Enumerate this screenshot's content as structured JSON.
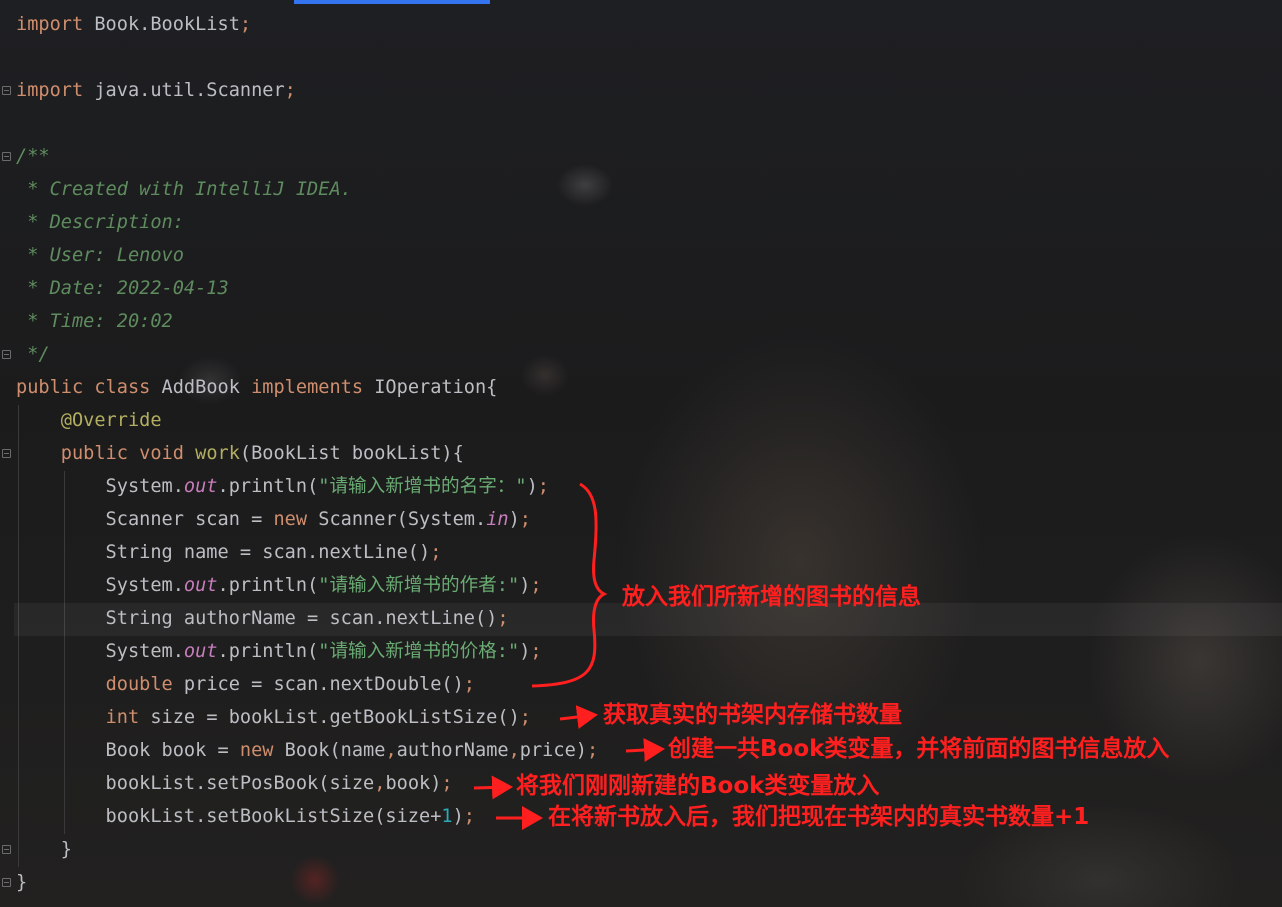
{
  "editor": {
    "lines": [
      [
        {
          "t": "import",
          "c": "kw"
        },
        {
          "t": " Book.BookList"
        },
        {
          "t": ";",
          "c": "kw"
        }
      ],
      [],
      [
        {
          "t": "import",
          "c": "kw"
        },
        {
          "t": " java.util.Scanner"
        },
        {
          "t": ";",
          "c": "kw"
        }
      ],
      [],
      [
        {
          "t": "/**",
          "c": "com"
        }
      ],
      [
        {
          "t": " * Created with IntelliJ IDEA.",
          "c": "com"
        }
      ],
      [
        {
          "t": " * Description:",
          "c": "com"
        }
      ],
      [
        {
          "t": " * User: Lenovo",
          "c": "com"
        }
      ],
      [
        {
          "t": " * Date: 2022-04-13",
          "c": "com"
        }
      ],
      [
        {
          "t": " * Time: 20:02",
          "c": "com"
        }
      ],
      [
        {
          "t": " */",
          "c": "com"
        }
      ],
      [
        {
          "t": "public class",
          "c": "kw"
        },
        {
          "t": " AddBook "
        },
        {
          "t": "implements",
          "c": "kw"
        },
        {
          "t": " IOperation{"
        }
      ],
      [
        {
          "t": "    "
        },
        {
          "t": "@Override",
          "c": "ann"
        }
      ],
      [
        {
          "t": "    "
        },
        {
          "t": "public void",
          "c": "kw"
        },
        {
          "t": " "
        },
        {
          "t": "work",
          "c": "ann"
        },
        {
          "t": "(BookList bookList){"
        }
      ],
      [
        {
          "t": "        System."
        },
        {
          "t": "out",
          "c": "st"
        },
        {
          "t": ".println("
        },
        {
          "t": "\"请输入新增书的名字：\"",
          "c": "str"
        },
        {
          "t": ")"
        },
        {
          "t": ";",
          "c": "kw"
        }
      ],
      [
        {
          "t": "        Scanner scan = "
        },
        {
          "t": "new",
          "c": "kw"
        },
        {
          "t": " Scanner(System."
        },
        {
          "t": "in",
          "c": "st"
        },
        {
          "t": ")"
        },
        {
          "t": ";",
          "c": "kw"
        }
      ],
      [
        {
          "t": "        String name = scan.nextLine()"
        },
        {
          "t": ";",
          "c": "kw"
        }
      ],
      [
        {
          "t": "        System."
        },
        {
          "t": "out",
          "c": "st"
        },
        {
          "t": ".println("
        },
        {
          "t": "\"请输入新增书的作者:\"",
          "c": "str"
        },
        {
          "t": ")"
        },
        {
          "t": ";",
          "c": "kw"
        }
      ],
      [
        {
          "t": "        String authorName = scan.nextLine()"
        },
        {
          "t": ";",
          "c": "kw"
        }
      ],
      [
        {
          "t": "        System."
        },
        {
          "t": "out",
          "c": "st"
        },
        {
          "t": ".println("
        },
        {
          "t": "\"请输入新增书的价格:\"",
          "c": "str"
        },
        {
          "t": ")"
        },
        {
          "t": ";",
          "c": "kw"
        }
      ],
      [
        {
          "t": "        "
        },
        {
          "t": "double",
          "c": "kw"
        },
        {
          "t": " price = scan.nextDouble()"
        },
        {
          "t": ";",
          "c": "kw"
        }
      ],
      [
        {
          "t": "        "
        },
        {
          "t": "int",
          "c": "kw"
        },
        {
          "t": " size = bookList.getBookListSize()"
        },
        {
          "t": ";",
          "c": "kw"
        }
      ],
      [
        {
          "t": "        Book book = "
        },
        {
          "t": "new",
          "c": "kw"
        },
        {
          "t": " Book(name"
        },
        {
          "t": ",",
          "c": "kw"
        },
        {
          "t": "authorName"
        },
        {
          "t": ",",
          "c": "kw"
        },
        {
          "t": "price)"
        },
        {
          "t": ";",
          "c": "kw"
        }
      ],
      [
        {
          "t": "        bookList.setPosBook(size"
        },
        {
          "t": ",",
          "c": "kw"
        },
        {
          "t": "book)"
        },
        {
          "t": ";",
          "c": "kw"
        }
      ],
      [
        {
          "t": "        bookList.setBookListSize(size+"
        },
        {
          "t": "1",
          "c": "num"
        },
        {
          "t": ")"
        },
        {
          "t": ";",
          "c": "kw"
        }
      ],
      [
        {
          "t": "    }"
        }
      ],
      [
        {
          "t": "}"
        }
      ]
    ]
  },
  "annotations": {
    "info_block": "放入我们所新增的图书的信息",
    "get_size": "获取真实的书架内存储书数量",
    "create_book": "创建一共Book类变量，并将前面的图书信息放入",
    "set_pos": "将我们刚刚新建的Book类变量放入",
    "update_size": "在将新书放入后，我们把现在书架内的真实书数量+1"
  },
  "colors": {
    "annotation_red": "#ff1f1f",
    "keyword": "#cf8e6d",
    "comment": "#5f8c5f",
    "string": "#6aab73",
    "static_field": "#c77dbb",
    "annotation_yellow": "#b3ae60",
    "number": "#2aacb8",
    "text": "#bcbec4",
    "tab_accent": "#3574f0"
  }
}
